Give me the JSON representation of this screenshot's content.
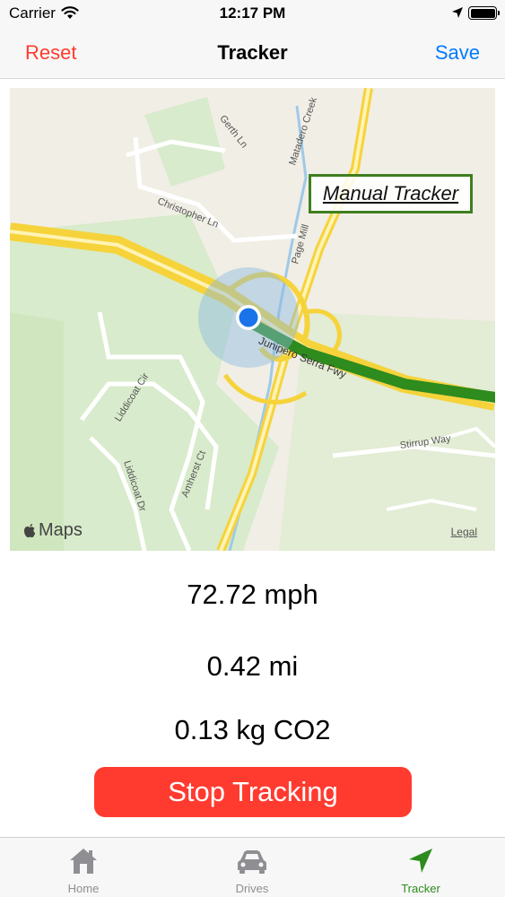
{
  "status_bar": {
    "carrier": "Carrier",
    "time": "12:17 PM"
  },
  "nav": {
    "reset_label": "Reset",
    "title": "Tracker",
    "save_label": "Save"
  },
  "map": {
    "overlay_label": "Manual Tracker",
    "attribution": "Maps",
    "legal": "Legal",
    "road_labels": {
      "gerth": "Gerth Ln",
      "matadero": "Matadero Creek",
      "christopher": "Christopher Ln",
      "page_mill": "Page Mill",
      "junipero": "Junipero Serra Fwy",
      "liddicoat_cir": "Liddicoat Cir",
      "liddicoat_dr": "Liddicoat Dr",
      "amherst": "Amherst Ct",
      "stirrup": "Stirrup Way"
    },
    "colors": {
      "route": "#2e8b1e",
      "location_dot": "#1a73e8",
      "highway": "#f6d33b"
    }
  },
  "stats": {
    "speed": "72.72 mph",
    "distance": "0.42 mi",
    "co2": "0.13 kg CO2"
  },
  "stop_button_label": "Stop Tracking",
  "tabs": [
    {
      "label": "Home",
      "icon": "house-icon",
      "active": false
    },
    {
      "label": "Drives",
      "icon": "car-icon",
      "active": false
    },
    {
      "label": "Tracker",
      "icon": "location-arrow-icon",
      "active": true
    }
  ],
  "colors": {
    "destructive": "#ff3b30",
    "accent": "#007aff",
    "tracker_green": "#2e8b1e"
  }
}
